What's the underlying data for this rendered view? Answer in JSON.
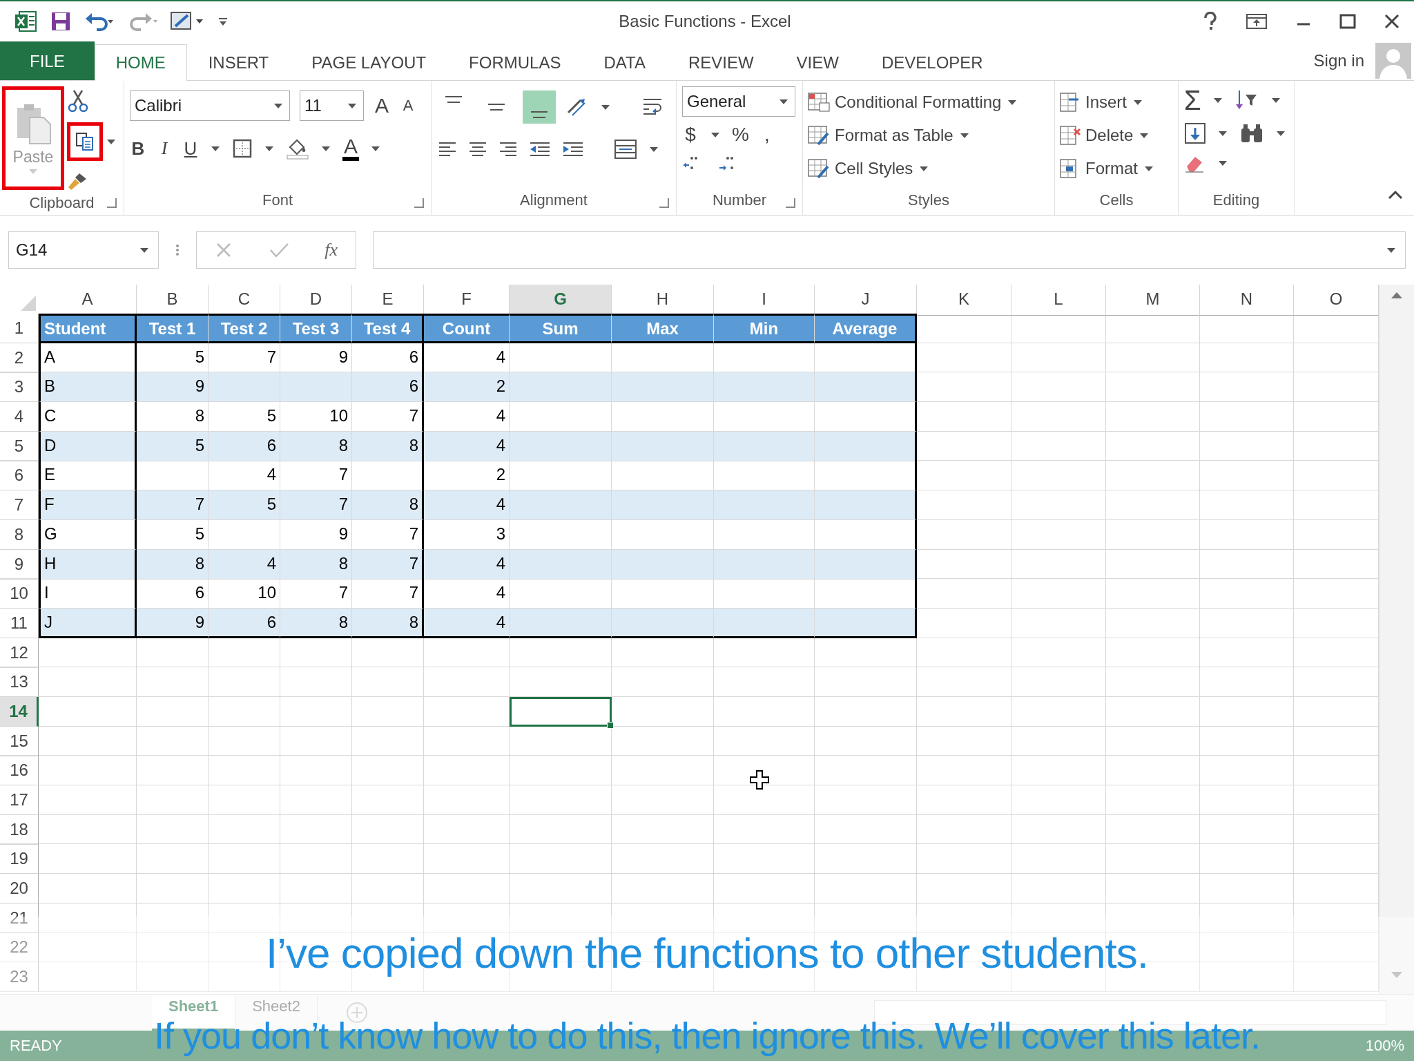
{
  "window": {
    "title": "Basic Functions - Excel"
  },
  "ribbon_tabs": [
    {
      "label": "FILE",
      "kind": "file",
      "selected": false
    },
    {
      "label": "HOME",
      "kind": "tab",
      "selected": true
    },
    {
      "label": "INSERT",
      "kind": "tab",
      "selected": false
    },
    {
      "label": "PAGE LAYOUT",
      "kind": "tab",
      "selected": false
    },
    {
      "label": "FORMULAS",
      "kind": "tab",
      "selected": false
    },
    {
      "label": "DATA",
      "kind": "tab",
      "selected": false
    },
    {
      "label": "REVIEW",
      "kind": "tab",
      "selected": false
    },
    {
      "label": "VIEW",
      "kind": "tab",
      "selected": false
    },
    {
      "label": "DEVELOPER",
      "kind": "tab",
      "selected": false
    }
  ],
  "account": {
    "label": "Sign in"
  },
  "clipboard": {
    "group": "Clipboard",
    "paste": {
      "label": "Paste",
      "highlighted": true
    },
    "copy": {
      "highlighted": true
    }
  },
  "font": {
    "group": "Font",
    "family": "Calibri",
    "size": "11",
    "grow": "A",
    "shrink": "A",
    "bold": "B",
    "italic": "I",
    "underline": "U",
    "text_color_label": "A"
  },
  "alignment": {
    "group": "Alignment",
    "vertical_align": [
      {
        "selected": false
      },
      {
        "selected": false
      },
      {
        "selected": true
      }
    ]
  },
  "number": {
    "group": "Number",
    "format": "General",
    "currency": "$",
    "percent": "%",
    "comma": ","
  },
  "styles": {
    "group": "Styles",
    "items": [
      "Conditional Formatting",
      "Format as Table",
      "Cell Styles"
    ]
  },
  "cells": {
    "group": "Cells",
    "items": [
      "Insert",
      "Delete",
      "Format"
    ]
  },
  "editing": {
    "group": "Editing",
    "sum": "Σ"
  },
  "formula_bar": {
    "name_box": "G14",
    "function_label": "fx"
  },
  "sheet": {
    "columns": [
      {
        "label": "A",
        "selected": false
      },
      {
        "label": "B",
        "selected": false
      },
      {
        "label": "C",
        "selected": false
      },
      {
        "label": "D",
        "selected": false
      },
      {
        "label": "E",
        "selected": false
      },
      {
        "label": "F",
        "selected": false
      },
      {
        "label": "G",
        "selected": true
      },
      {
        "label": "H",
        "selected": false
      },
      {
        "label": "I",
        "selected": false
      },
      {
        "label": "J",
        "selected": false
      },
      {
        "label": "K",
        "selected": false
      },
      {
        "label": "L",
        "selected": false
      },
      {
        "label": "M",
        "selected": false
      },
      {
        "label": "N",
        "selected": false
      },
      {
        "label": "O",
        "selected": false
      }
    ],
    "rows": [
      {
        "label": "1",
        "selected": false,
        "cells": [
          "Student",
          "Test 1",
          "Test 2",
          "Test 3",
          "Test 4",
          "Count",
          "Sum",
          "Max",
          "Min",
          "Average"
        ]
      },
      {
        "label": "2",
        "selected": false,
        "cells": [
          "A",
          "5",
          "7",
          "9",
          "6",
          "4",
          null,
          null,
          null,
          null
        ]
      },
      {
        "label": "3",
        "selected": false,
        "cells": [
          "B",
          "9",
          null,
          null,
          "6",
          "2",
          null,
          null,
          null,
          null
        ]
      },
      {
        "label": "4",
        "selected": false,
        "cells": [
          "C",
          "8",
          "5",
          "10",
          "7",
          "4",
          null,
          null,
          null,
          null
        ]
      },
      {
        "label": "5",
        "selected": false,
        "cells": [
          "D",
          "5",
          "6",
          "8",
          "8",
          "4",
          null,
          null,
          null,
          null
        ]
      },
      {
        "label": "6",
        "selected": false,
        "cells": [
          "E",
          null,
          "4",
          "7",
          null,
          "2",
          null,
          null,
          null,
          null
        ]
      },
      {
        "label": "7",
        "selected": false,
        "cells": [
          "F",
          "7",
          "5",
          "7",
          "8",
          "4",
          null,
          null,
          null,
          null
        ]
      },
      {
        "label": "8",
        "selected": false,
        "cells": [
          "G",
          "5",
          null,
          "9",
          "7",
          "3",
          null,
          null,
          null,
          null
        ]
      },
      {
        "label": "9",
        "selected": false,
        "cells": [
          "H",
          "8",
          "4",
          "8",
          "7",
          "4",
          null,
          null,
          null,
          null
        ]
      },
      {
        "label": "10",
        "selected": false,
        "cells": [
          "I",
          "6",
          "10",
          "7",
          "7",
          "4",
          null,
          null,
          null,
          null
        ]
      },
      {
        "label": "11",
        "selected": false,
        "cells": [
          "J",
          "9",
          "6",
          "8",
          "8",
          "4",
          null,
          null,
          null,
          null
        ]
      },
      {
        "label": "12",
        "selected": false,
        "cells": []
      },
      {
        "label": "13",
        "selected": false,
        "cells": []
      },
      {
        "label": "14",
        "selected": true,
        "cells": []
      },
      {
        "label": "15",
        "selected": false,
        "cells": []
      },
      {
        "label": "16",
        "selected": false,
        "cells": []
      },
      {
        "label": "17",
        "selected": false,
        "cells": []
      },
      {
        "label": "18",
        "selected": false,
        "cells": []
      },
      {
        "label": "19",
        "selected": false,
        "cells": []
      },
      {
        "label": "20",
        "selected": false,
        "cells": []
      },
      {
        "label": "21",
        "selected": false,
        "cells": []
      },
      {
        "label": "22",
        "selected": false,
        "cells": []
      },
      {
        "label": "23",
        "selected": false,
        "cells": []
      }
    ]
  },
  "sheet_tabs": [
    {
      "label": "Sheet1",
      "selected": true
    },
    {
      "label": "Sheet2",
      "selected": false
    }
  ],
  "status_bar": {
    "mode": "READY",
    "zoom": "100%"
  },
  "captions": [
    "I’ve copied down the functions to other students.",
    "If you don’t know how to do this, then ignore this. We’ll cover this later."
  ]
}
